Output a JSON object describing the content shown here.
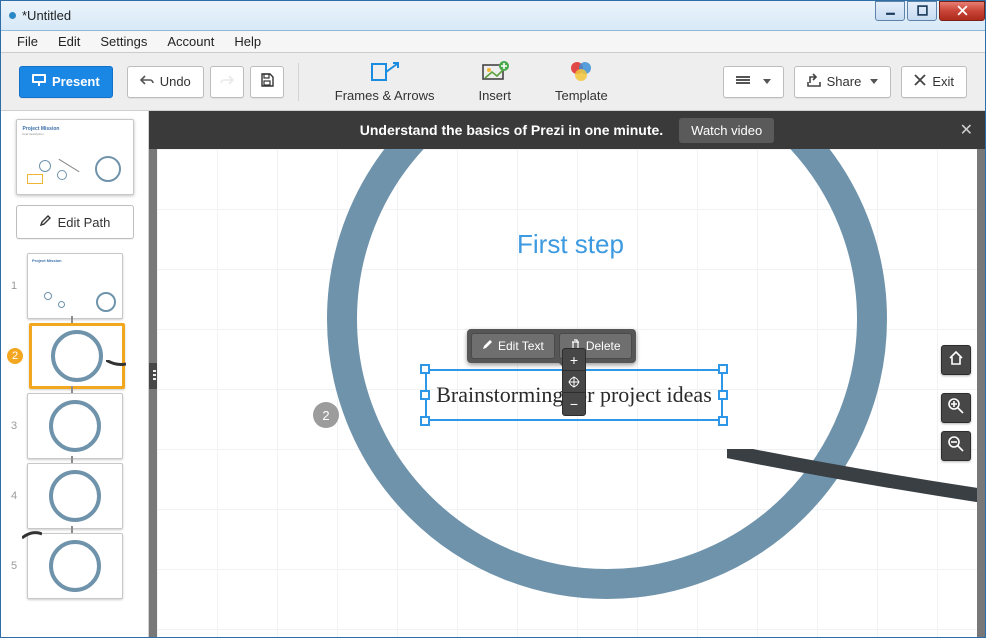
{
  "window": {
    "title": "*Untitled"
  },
  "menu": {
    "items": [
      "File",
      "Edit",
      "Settings",
      "Account",
      "Help"
    ]
  },
  "toolbar": {
    "present": "Present",
    "undo": "Undo",
    "frames": "Frames & Arrows",
    "insert": "Insert",
    "template": "Template",
    "share": "Share",
    "exit": "Exit"
  },
  "banner": {
    "text": "Understand the basics of Prezi in one minute.",
    "watch": "Watch video"
  },
  "sidebar": {
    "edit_path": "Edit Path",
    "items": [
      {
        "num": "1"
      },
      {
        "num": "2"
      },
      {
        "num": "3"
      },
      {
        "num": "4"
      },
      {
        "num": "5"
      }
    ]
  },
  "canvas": {
    "heading": "First step",
    "step_num": "2",
    "selected_text": "Brainstorming for project ideas"
  },
  "context": {
    "edit": "Edit Text",
    "delete": "Delete"
  },
  "zoom": {
    "plus": "+",
    "minus": "−"
  }
}
